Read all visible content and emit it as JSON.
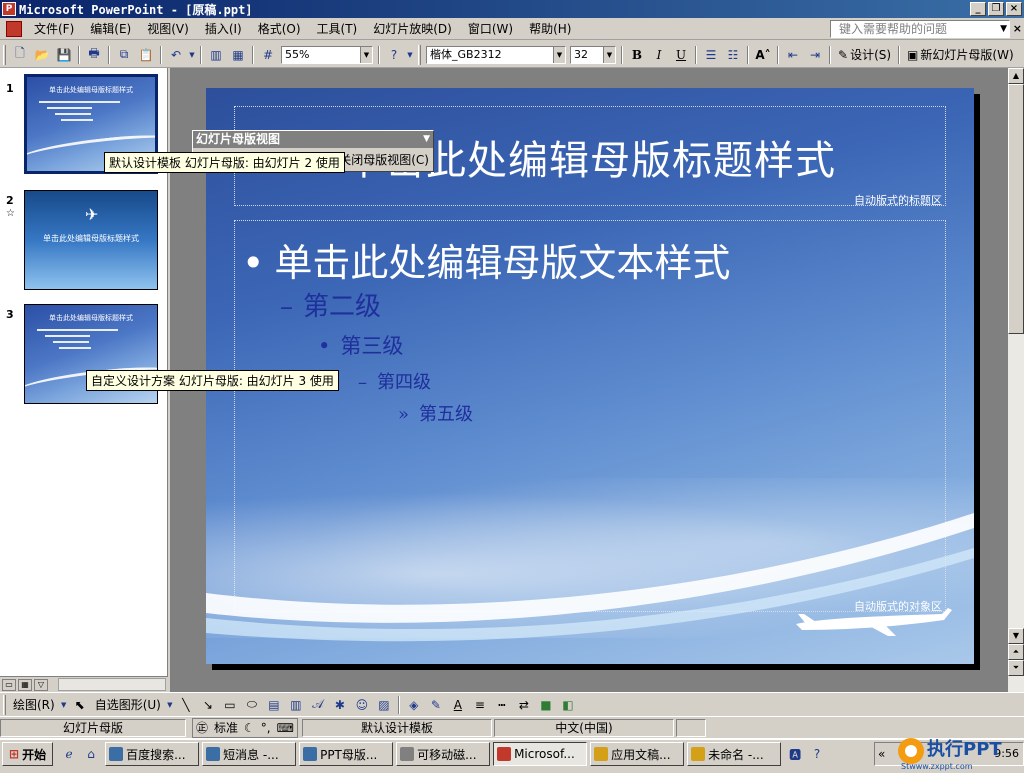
{
  "window": {
    "title": "Microsoft PowerPoint - [原稿.ppt]",
    "controls": [
      "_",
      "❐",
      "×"
    ]
  },
  "menu": {
    "items": [
      "文件(F)",
      "编辑(E)",
      "视图(V)",
      "插入(I)",
      "格式(O)",
      "工具(T)",
      "幻灯片放映(D)",
      "窗口(W)",
      "帮助(H)"
    ],
    "help_placeholder": "键入需要帮助的问题"
  },
  "toolbar": {
    "zoom": "55%",
    "font_name": "楷体_GB2312",
    "font_size": "32",
    "bold": "B",
    "italic": "I",
    "underline": "U",
    "design_label": "设计(S)",
    "new_master_label": "新幻灯片母版(W)"
  },
  "thumbnails": [
    {
      "num": "1",
      "selected": true
    },
    {
      "num": "2",
      "marker": "☆"
    },
    {
      "num": "3"
    }
  ],
  "thumb_text": {
    "t1_title": "单击此处编辑母版标题样式",
    "t2_title": "单击此处编辑母版标题样式"
  },
  "tooltips": {
    "tip1": "默认设计模板 幻灯片母版: 由幻灯片 2 使用",
    "tip2": "自定义设计方案 幻灯片母版: 由幻灯片 3 使用"
  },
  "master_toolbar": {
    "title": "幻灯片母版视图",
    "close_button": "关闭母版视图(C)"
  },
  "slide": {
    "title": "单击此处编辑母版标题样式",
    "title_area_label": "自动版式的标题区",
    "level1": "单击此处编辑母版文本样式",
    "level2": "第二级",
    "level3": "第三级",
    "level4": "第四级",
    "level5": "第五级",
    "object_area_label": "自动版式的对象区"
  },
  "drawing_toolbar": {
    "draw": "绘图(R)",
    "autoshapes": "自选图形(U)"
  },
  "status": {
    "view": "幻灯片母版",
    "ime_std": "标准",
    "template": "默认设计模板",
    "language": "中文(中国)"
  },
  "taskbar": {
    "start": "开始",
    "tasks": [
      {
        "label": "百度搜索..."
      },
      {
        "label": "短消息 -..."
      },
      {
        "label": "PPT母版..."
      },
      {
        "label": "可移动磁..."
      },
      {
        "label": "Microsof...",
        "active": true
      },
      {
        "label": "应用文稿..."
      },
      {
        "label": "未命名 -..."
      }
    ],
    "clock": "9:56",
    "watermark": "执行PPT",
    "watermark_url": "Stwww.zxppt.com"
  }
}
